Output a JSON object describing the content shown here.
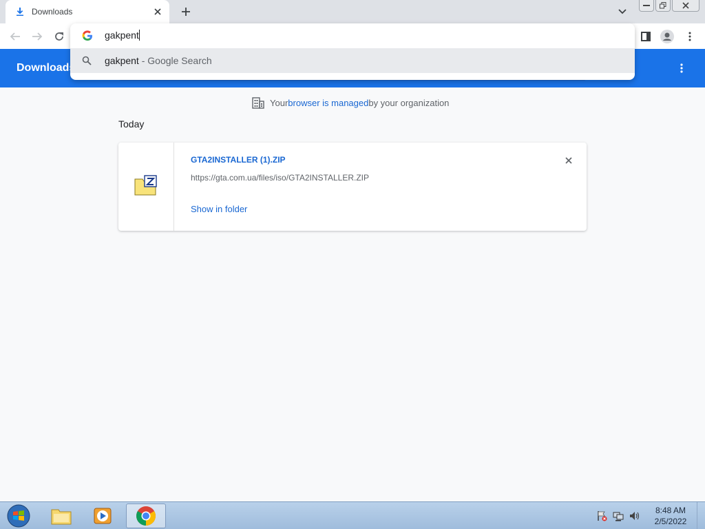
{
  "tab": {
    "title": "Downloads"
  },
  "omnibox": {
    "input_text": "gakpent",
    "suggestion_query": "gakpent",
    "suggestion_suffix": " - Google Search"
  },
  "page": {
    "title": "Downloads",
    "managed_prefix": "Your ",
    "managed_link": "browser is managed",
    "managed_suffix": " by your organization",
    "section_label": "Today"
  },
  "download": {
    "file_name": "GTA2INSTALLER (1).ZIP",
    "url": "https://gta.com.ua/files/iso/GTA2INSTALLER.ZIP",
    "action_label": "Show in folder"
  },
  "taskbar": {
    "time": "8:48 AM",
    "date": "2/5/2022"
  },
  "colors": {
    "accent": "#1a73e8",
    "link": "#1967d2"
  }
}
